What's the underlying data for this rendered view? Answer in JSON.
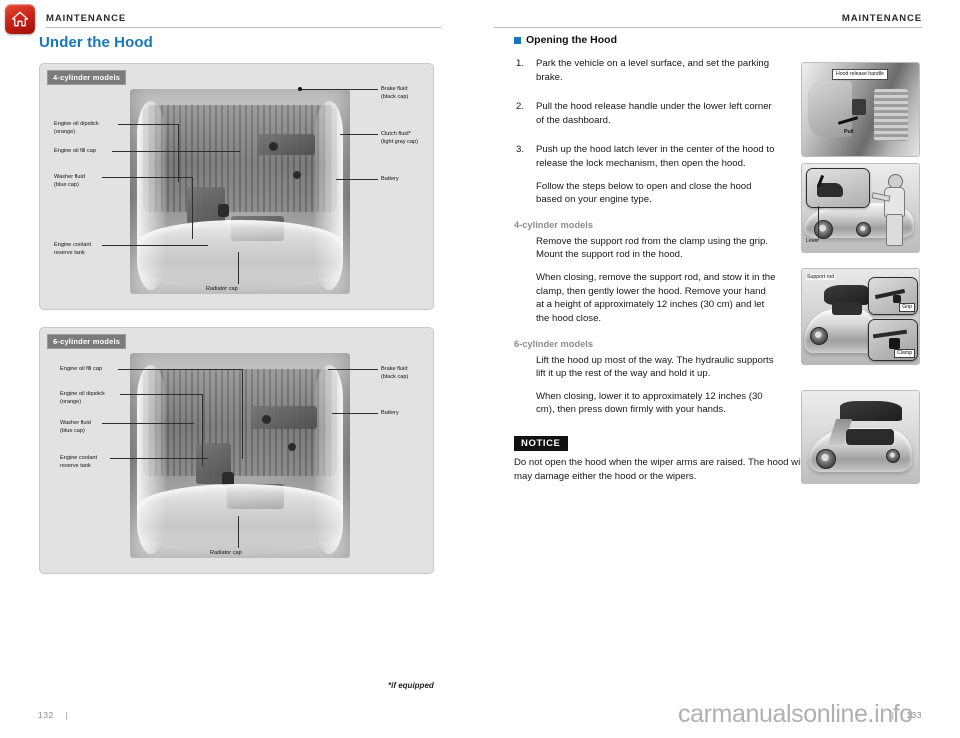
{
  "header": {
    "home_icon": "home-icon",
    "left_running_head": "MAINTENANCE",
    "right_running_head": "MAINTENANCE"
  },
  "left_column": {
    "page_title": "Under the Hood",
    "figures": [
      {
        "tag": "4-cylinder models",
        "callouts_left": [
          "Engine oil dipstick\n(orange)",
          "Engine oil fill cap",
          "Washer fluid\n(blue cap)",
          "Engine coolant\nreserve tank"
        ],
        "callouts_right": [
          "Brake fluid\n(black cap)",
          "Clutch fluid*\n(light gray cap)",
          "Battery"
        ],
        "callout_bottom": "Radiator cap"
      },
      {
        "tag": "6-cylinder models",
        "callouts_left": [
          "Engine oil fill cap",
          "Engine oil dipstick\n(orange)",
          "Washer fluid\n(blue cap)",
          "Engine coolant\nreserve tank"
        ],
        "callouts_right": [
          "Brake fluid\n(black cap)",
          "Battery"
        ],
        "callout_bottom": "Radiator cap"
      }
    ]
  },
  "right_column": {
    "section_heading": "Opening the Hood",
    "steps": [
      {
        "num": "1.",
        "text": "Park the vehicle on a level surface, and set the parking brake."
      },
      {
        "num": "2.",
        "text": "Pull the hood release handle under the lower left corner of the dashboard."
      },
      {
        "num": "3.",
        "text": "Push up the hood latch lever in the center of the hood to release the lock mechanism, then open the hood."
      }
    ],
    "step3_follow": "Follow the steps below to open and close the hood based on your engine type.",
    "engine_sections": [
      {
        "heading": "4-cylinder models",
        "paragraphs": [
          "Remove the support rod from the clamp using the grip. Mount the support rod in the hood.",
          "When closing, remove the support rod, and stow it in the clamp, then gently lower the hood. Remove your hand at a height of approximately 12 inches (30 cm) and let the hood close."
        ]
      },
      {
        "heading": "6-cylinder models",
        "paragraphs": [
          "Lift the hood up most of the way. The hydraulic supports lift it up the rest of the way and hold it up.",
          "When closing, lower it to approximately 12 inches (30 cm), then press down firmly with your hands."
        ]
      }
    ],
    "notice": {
      "tag": "NOTICE",
      "body": "Do not open the hood when the wiper arms are raised. The hood will strike the wipers, and may damage either the hood or the wipers."
    },
    "photos": [
      {
        "labels": [
          "Hood release handle"
        ],
        "extra_text": [
          "Pull"
        ]
      },
      {
        "labels": [
          "Lever"
        ],
        "extra_text": []
      },
      {
        "labels": [
          "Support rod",
          "Grip",
          "Clamp"
        ],
        "extra_text": []
      },
      {
        "labels": [],
        "extra_text": []
      }
    ]
  },
  "footer": {
    "footnote": "*if equipped",
    "page_left": "132",
    "page_divider_left": "|",
    "page_divider_right": "|",
    "page_right": "133",
    "watermark": "carmanualsonline.info"
  },
  "colors": {
    "accent_blue": "#1878b4",
    "tag_gray": "#7b7b7b",
    "notice_black": "#111111",
    "home_red": "#cf2418"
  }
}
